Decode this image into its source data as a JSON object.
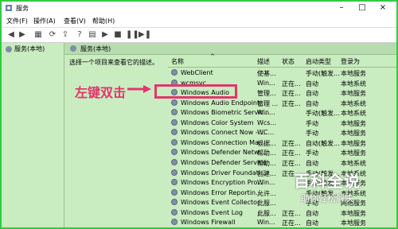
{
  "window": {
    "title": "服务"
  },
  "menu": [
    "文件(F)",
    "操作(A)",
    "查看(V)",
    "帮助(H)"
  ],
  "tree": {
    "root": "服务(本地)"
  },
  "pane": {
    "header": "服务(本地)",
    "hint": "选择一个项目来查看它的描述。"
  },
  "columns": [
    "名称",
    "描述",
    "状态",
    "启动类型",
    "登录为"
  ],
  "rows": [
    {
      "name": "WebClient",
      "desc": "使基...",
      "status": "",
      "startup": "手动(触发...",
      "logon": "本地服务"
    },
    {
      "name": "wcmsvc",
      "desc": "Win...",
      "status": "正在...",
      "startup": "自动",
      "logon": "本地系统"
    },
    {
      "name": "Windows Audio",
      "desc": "管理...",
      "status": "正在...",
      "startup": "自动",
      "logon": "本地服务"
    },
    {
      "name": "Windows Audio Endpoint...",
      "desc": "管理 ...",
      "status": "正在...",
      "startup": "自动",
      "logon": "本地系统"
    },
    {
      "name": "Windows Biometric Servic...",
      "desc": "Win...",
      "status": "",
      "startup": "手动(触发...",
      "logon": "本地系统"
    },
    {
      "name": "Windows Color System",
      "desc": "Wcs...",
      "status": "",
      "startup": "手动",
      "logon": "本地服务"
    },
    {
      "name": "Windows Connect Now - ...",
      "desc": "WC...",
      "status": "",
      "startup": "手动",
      "logon": "本地服务"
    },
    {
      "name": "Windows Connection Ma...",
      "desc": "根据...",
      "status": "正在...",
      "startup": "自动(触发...",
      "logon": "本地服务"
    },
    {
      "name": "Windows Defender Netw...",
      "desc": "帮助...",
      "status": "正在...",
      "startup": "手动",
      "logon": "本地服务"
    },
    {
      "name": "Windows Defender Service",
      "desc": "帮助...",
      "status": "正在...",
      "startup": "自动",
      "logon": "本地系统"
    },
    {
      "name": "Windows Driver Foundati...",
      "desc": "创建...",
      "status": "正在...",
      "startup": "手动(触发...",
      "logon": "本地系统"
    },
    {
      "name": "Windows Encryption Pro...",
      "desc": "Win...",
      "status": "",
      "startup": "手动(触发...",
      "logon": "本地服务"
    },
    {
      "name": "Windows Error Reportin...",
      "desc": "允许...",
      "status": "",
      "startup": "手动(触发...",
      "logon": "本地系统"
    },
    {
      "name": "Windows Event Collector",
      "desc": "此服...",
      "status": "",
      "startup": "手动",
      "logon": "网络服务"
    },
    {
      "name": "Windows Event Log",
      "desc": "此服...",
      "status": "正在...",
      "startup": "自动",
      "logon": "本地服务"
    },
    {
      "name": "Windows Firewall",
      "desc": "Win...",
      "status": "正在...",
      "startup": "自动",
      "logon": "本地服务"
    }
  ],
  "annotation": "左键双击",
  "watermark": {
    "title": "百科全说",
    "subtitle": "助你轻松解决"
  },
  "colors": {
    "highlight": "#e3366b",
    "frame": "#2ecc40",
    "background": "#c9ecc0"
  }
}
